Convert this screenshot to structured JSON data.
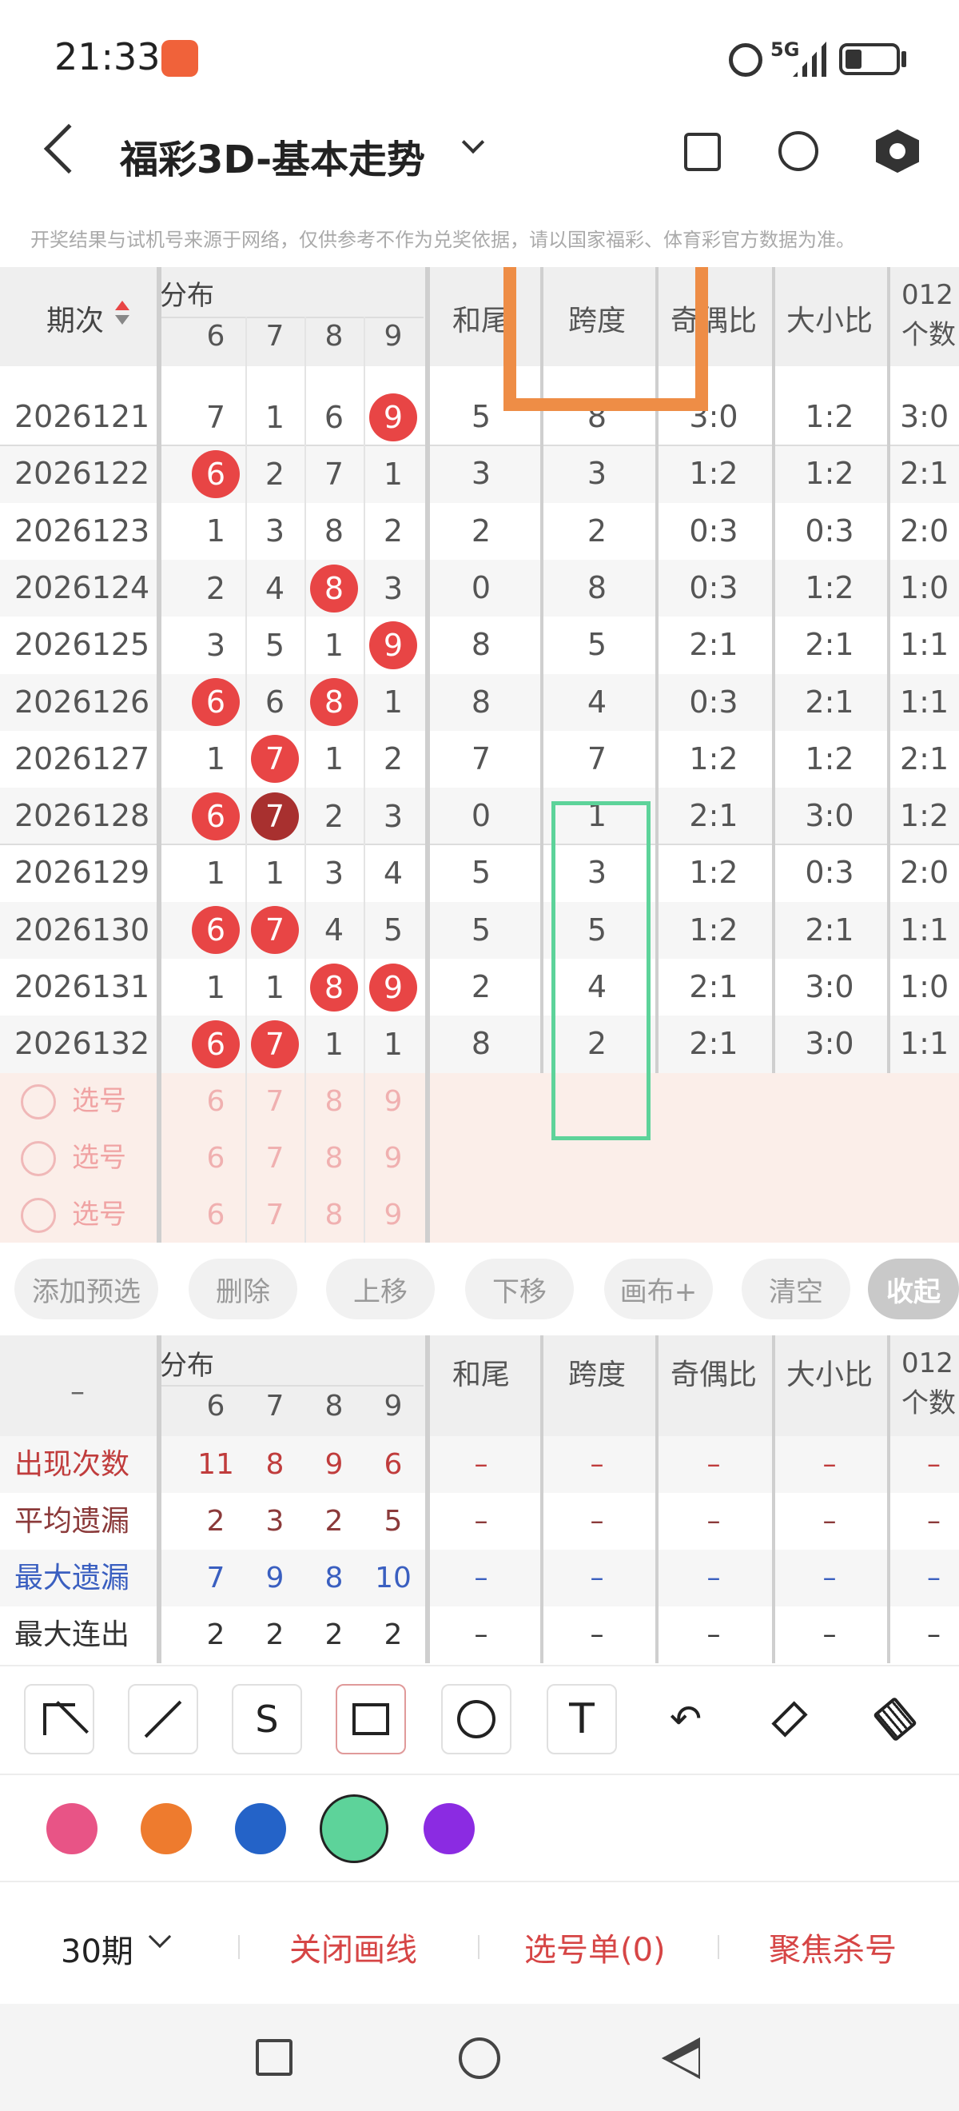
{
  "status": {
    "time": "21:33",
    "network": "5G"
  },
  "header": {
    "title": "福彩3D-基本走势"
  },
  "notice": "开奖结果与试机号来源于网络，仅供参考不作为兑奖依据，请以国家福彩、体育彩官方数据为准。",
  "table": {
    "col_period": "期次",
    "group_label": "分布",
    "digits": [
      "6",
      "7",
      "8",
      "9"
    ],
    "col_hewei": "和尾",
    "col_kuadu": "跨度",
    "col_jiou": "奇偶比",
    "col_daxiao": "大小比",
    "col_012": "012个数",
    "rows": [
      {
        "period": "2026121",
        "d": [
          "7",
          "1",
          "6",
          "9"
        ],
        "hot": [
          3
        ],
        "hw": "5",
        "kd": "8",
        "jo": "3:0",
        "dx": "1:2",
        "c": "3:0"
      },
      {
        "period": "2026122",
        "d": [
          "6",
          "2",
          "7",
          "1"
        ],
        "hot": [
          0
        ],
        "hw": "3",
        "kd": "3",
        "jo": "1:2",
        "dx": "1:2",
        "c": "2:1"
      },
      {
        "period": "2026123",
        "d": [
          "1",
          "3",
          "8",
          "2"
        ],
        "hot": [],
        "hw": "2",
        "kd": "2",
        "jo": "0:3",
        "dx": "0:3",
        "c": "2:0"
      },
      {
        "period": "2026124",
        "d": [
          "2",
          "4",
          "8",
          "3"
        ],
        "hot": [
          2
        ],
        "hw": "0",
        "kd": "8",
        "jo": "0:3",
        "dx": "1:2",
        "c": "1:0"
      },
      {
        "period": "2026125",
        "d": [
          "3",
          "5",
          "1",
          "9"
        ],
        "hot": [
          3
        ],
        "hw": "8",
        "kd": "5",
        "jo": "2:1",
        "dx": "2:1",
        "c": "1:1"
      },
      {
        "period": "2026126",
        "d": [
          "6",
          "6",
          "8",
          "1"
        ],
        "hot": [
          0,
          2
        ],
        "hw": "8",
        "kd": "4",
        "jo": "0:3",
        "dx": "2:1",
        "c": "1:1"
      },
      {
        "period": "2026127",
        "d": [
          "1",
          "7",
          "1",
          "2"
        ],
        "hot": [
          1
        ],
        "hw": "7",
        "kd": "7",
        "jo": "1:2",
        "dx": "1:2",
        "c": "2:1"
      },
      {
        "period": "2026128",
        "d": [
          "6",
          "7",
          "2",
          "3"
        ],
        "hot": [
          0,
          1
        ],
        "dark": [
          1
        ],
        "hw": "0",
        "kd": "1",
        "jo": "2:1",
        "dx": "3:0",
        "c": "1:2"
      },
      {
        "period": "2026129",
        "d": [
          "1",
          "1",
          "3",
          "4"
        ],
        "hot": [],
        "hw": "5",
        "kd": "3",
        "jo": "1:2",
        "dx": "0:3",
        "c": "2:0"
      },
      {
        "period": "2026130",
        "d": [
          "6",
          "7",
          "4",
          "5"
        ],
        "hot": [
          0,
          1
        ],
        "hw": "5",
        "kd": "5",
        "jo": "1:2",
        "dx": "2:1",
        "c": "1:1"
      },
      {
        "period": "2026131",
        "d": [
          "1",
          "1",
          "8",
          "9"
        ],
        "hot": [
          2,
          3
        ],
        "hw": "2",
        "kd": "4",
        "jo": "2:1",
        "dx": "3:0",
        "c": "1:0"
      },
      {
        "period": "2026132",
        "d": [
          "6",
          "7",
          "1",
          "1"
        ],
        "hot": [
          0,
          1
        ],
        "hw": "8",
        "kd": "2",
        "jo": "2:1",
        "dx": "3:0",
        "c": "1:1"
      }
    ],
    "select_label": "选号",
    "select_digits": [
      "6",
      "7",
      "8",
      "9"
    ]
  },
  "actions": [
    "添加预选",
    "删除",
    "上移",
    "下移",
    "画布+",
    "清空",
    "收起"
  ],
  "stats": {
    "dash": "–",
    "rows": [
      {
        "label": "出现次数",
        "color": "#c03c3c",
        "v": [
          "11",
          "8",
          "9",
          "6"
        ]
      },
      {
        "label": "平均遗漏",
        "color": "#8b3a3a",
        "v": [
          "2",
          "3",
          "2",
          "5"
        ]
      },
      {
        "label": "最大遗漏",
        "color": "#3a5fc0",
        "v": [
          "7",
          "9",
          "8",
          "10"
        ]
      },
      {
        "label": "最大连出",
        "color": "#333333",
        "v": [
          "2",
          "2",
          "2",
          "2"
        ]
      }
    ]
  },
  "tools": [
    "arrow-tool-icon",
    "line-tool-icon",
    "curve-tool-icon",
    "rectangle-tool-icon",
    "circle-tool-icon",
    "text-tool-icon",
    "undo-icon",
    "eraser-icon",
    "clear-brush-icon"
  ],
  "palette": [
    "#e85486",
    "#ee7b2e",
    "#2463c8",
    "#5dd39a",
    "#8b2be2"
  ],
  "bottom": {
    "period_select": "30期",
    "close_draw": "关闭画线",
    "select_list": "选号单(0)",
    "focus_kill": "聚焦杀号"
  }
}
